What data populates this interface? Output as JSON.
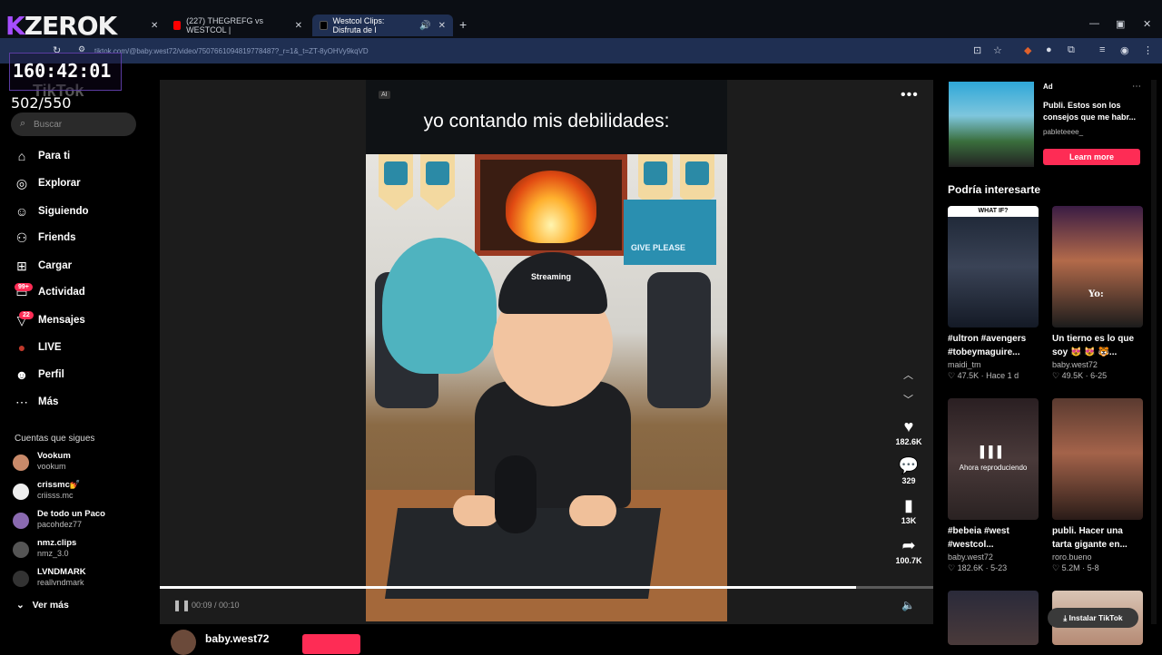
{
  "browser": {
    "tabs": [
      {
        "label": "(227) THEGREFG vs WESTCOL |",
        "color": "#ff0000"
      },
      {
        "label": "Westcol Clips: Disfruta de l",
        "color": "#111111"
      }
    ],
    "url": "tiktok.com/@baby.west72/video/7507661094819778487?_r=1&_t=ZT-8yOHVy9kqVD"
  },
  "overlay": {
    "logo_k": "K",
    "logo_rest": "ZEROK",
    "timer": "160:42:01",
    "counter": "502/550",
    "tiktok_text": "TikTok"
  },
  "sidebar": {
    "search_placeholder": "Buscar",
    "nav": [
      {
        "label": "Para ti",
        "icon": "⌂"
      },
      {
        "label": "Explorar",
        "icon": "◎"
      },
      {
        "label": "Siguiendo",
        "icon": "☺"
      },
      {
        "label": "Friends",
        "icon": "⚇"
      },
      {
        "label": "Cargar",
        "icon": "⊞"
      },
      {
        "label": "Actividad",
        "icon": "▭"
      },
      {
        "label": "Mensajes",
        "icon": "▽"
      },
      {
        "label": "LIVE",
        "icon": "●"
      },
      {
        "label": "Perfil",
        "icon": "☻"
      },
      {
        "label": "Más",
        "icon": "⋯"
      }
    ],
    "badges": {
      "actividad": "99+",
      "mensajes": "22"
    },
    "following_title": "Cuentas que sigues",
    "accounts": [
      {
        "name": "Vookum",
        "handle": "vookum",
        "color": "#c98a6a"
      },
      {
        "name": "crissmc💅",
        "handle": "criisss.mc",
        "color": "#eeeeee"
      },
      {
        "name": "De todo un Paco",
        "handle": "pacohdez77",
        "color": "#8a6ab0"
      },
      {
        "name": "nmz.clips",
        "handle": "nmz_3.0",
        "color": "#555555"
      },
      {
        "name": "LVNDMARK",
        "handle": "reallvndmark",
        "color": "#333333"
      }
    ],
    "see_more": "Ver más"
  },
  "player": {
    "ai_tag": "AI",
    "caption": "yo contando mis debilidades:",
    "cap_text": "Streaming",
    "poster_text": "GIVE PLEASE",
    "elapsed": "00:09",
    "duration": "00:10",
    "progress": 0.9,
    "time_display": "00:09 / 00:10",
    "likes": "182.6K",
    "comments": "329",
    "saves": "13K",
    "shares": "100.7K",
    "author": "baby.west72"
  },
  "ad": {
    "label": "Ad",
    "text": "Publi. Estos son los consejos que me habr...",
    "user": "pableteeee_",
    "cta": "Learn more"
  },
  "recommendations": {
    "title": "Podría interesarte",
    "cards": [
      {
        "caption": "#ultron #avengers #tobeymaguire...",
        "user": "maidi_tm",
        "meta": "♡ 47.5K · Hace 1 d",
        "overlay": "WHAT IF?"
      },
      {
        "caption": "Un tierno es lo que soy 😻 😻 🐯...",
        "user": "baby.west72",
        "meta": "♡ 49.5K · 6-25",
        "overlay": "Yo:"
      },
      {
        "caption": "#bebeia #west #westcol...",
        "user": "baby.west72",
        "meta": "♡ 182.6K · 5-23",
        "overlay": "Ahora reproduciendo"
      },
      {
        "caption": "publi. Hacer una tarta gigante en...",
        "user": "roro.bueno",
        "meta": "♡ 5.2M · 5-8",
        "overlay": ""
      }
    ],
    "install": "Instalar TikTok"
  }
}
